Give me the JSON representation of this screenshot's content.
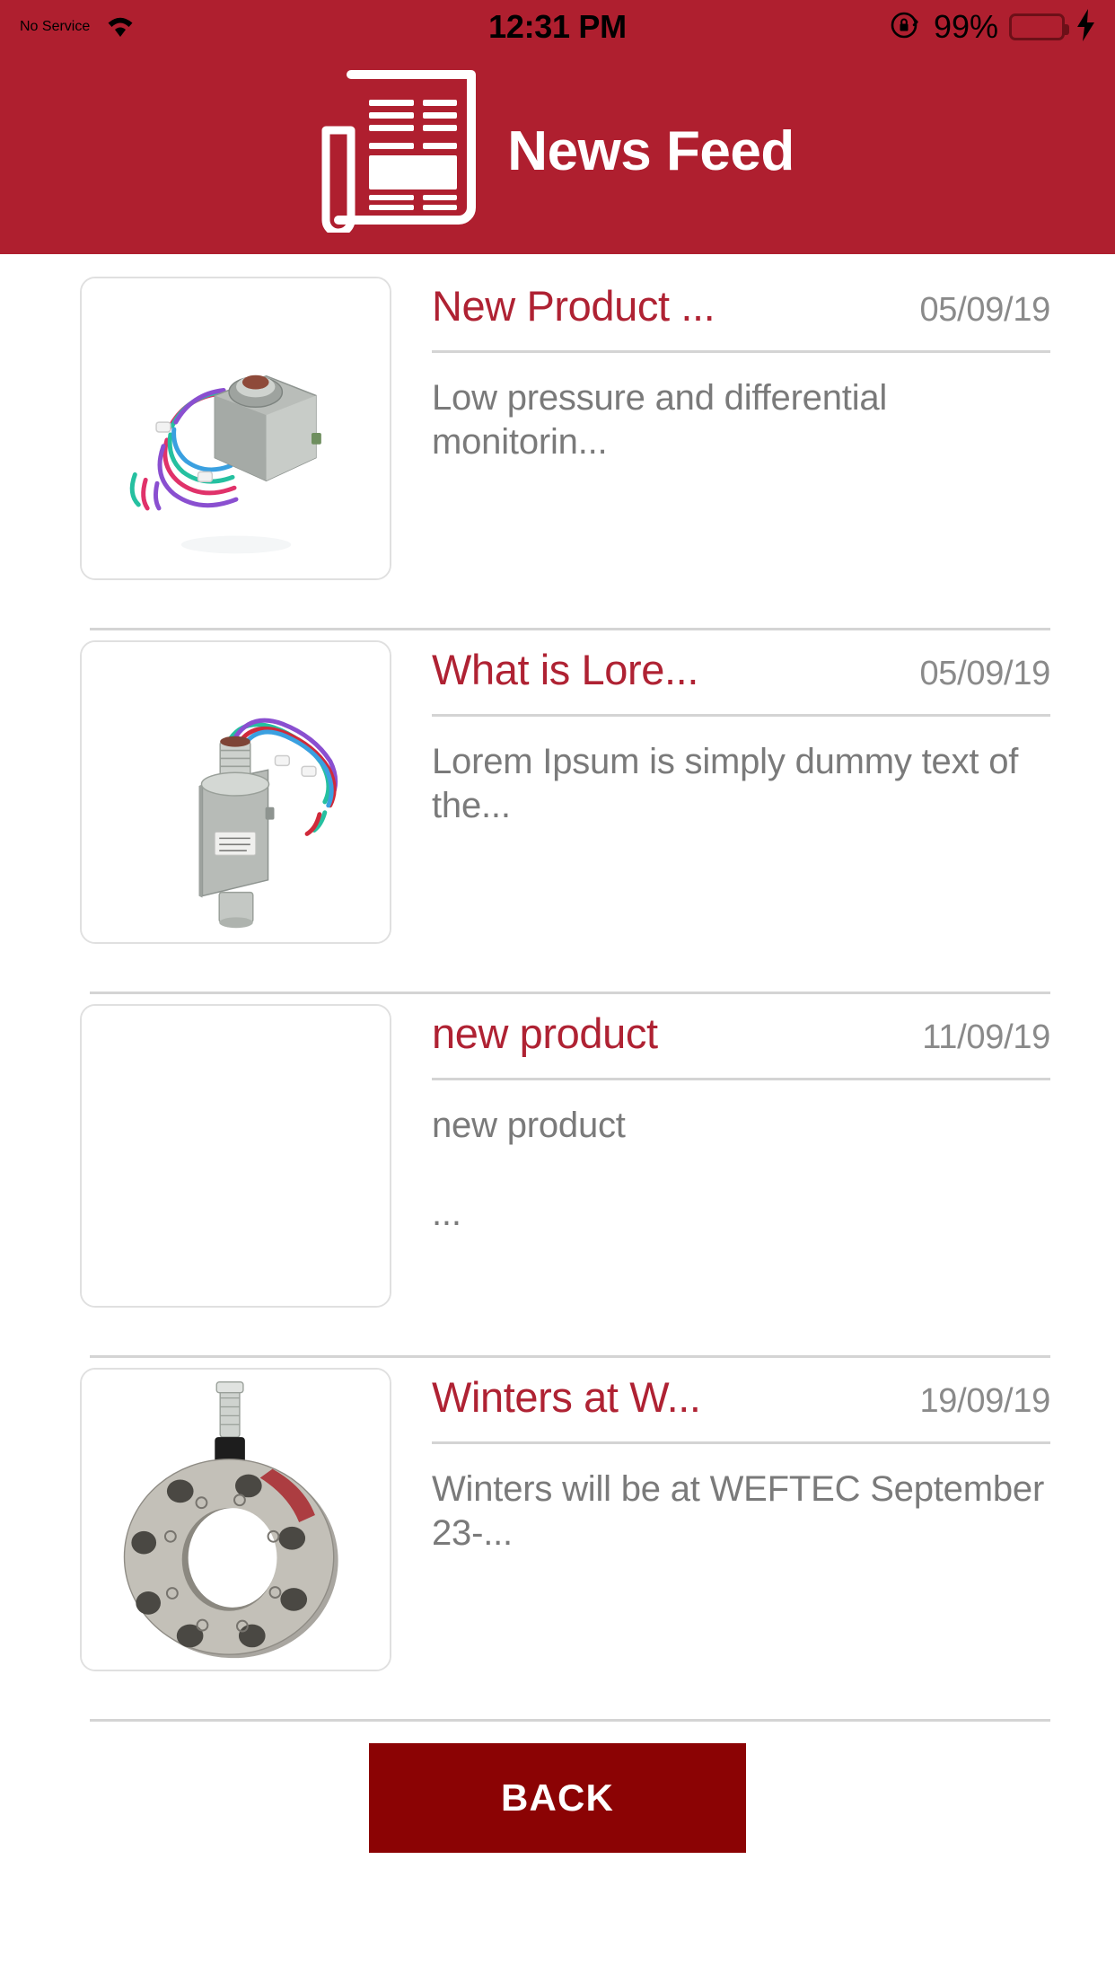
{
  "status_bar": {
    "carrier": "No Service",
    "wifi_icon": "wifi-icon",
    "time": "12:31 PM",
    "rotation_lock_icon": "rotation-lock-icon",
    "battery_percent": "99%",
    "battery_icon": "battery-icon",
    "charging_icon": "lightning-bolt-icon"
  },
  "header": {
    "icon": "newspaper-icon",
    "title": "News Feed",
    "background_color": "#AF1F2F"
  },
  "colors": {
    "brand_red": "#AF1F2F",
    "title_red": "#AF2233",
    "button_red": "#8B0304",
    "muted_text": "#7a7a7a",
    "date_text": "#8a8a8a",
    "divider": "#d4d4d4"
  },
  "feed": {
    "items": [
      {
        "thumbnail": "pressure-switch-coiled-wires-image",
        "has_image": true,
        "title": "New Product ...",
        "date": "05/09/19",
        "description": "Low pressure and differential monitorin..."
      },
      {
        "thumbnail": "vertical-pressure-switch-image",
        "has_image": true,
        "title": "What is Lore...",
        "date": "05/09/19",
        "description": "Lorem Ipsum is simply dummy text of the..."
      },
      {
        "thumbnail": "empty-thumbnail",
        "has_image": false,
        "title": "new product",
        "date": "11/09/19",
        "description": "new product\n\n..."
      },
      {
        "thumbnail": "flange-sensor-image",
        "has_image": true,
        "title": "Winters at W...",
        "date": "19/09/19",
        "description": "Winters will be at WEFTEC September 23-..."
      }
    ]
  },
  "footer": {
    "back_label": "BACK"
  }
}
